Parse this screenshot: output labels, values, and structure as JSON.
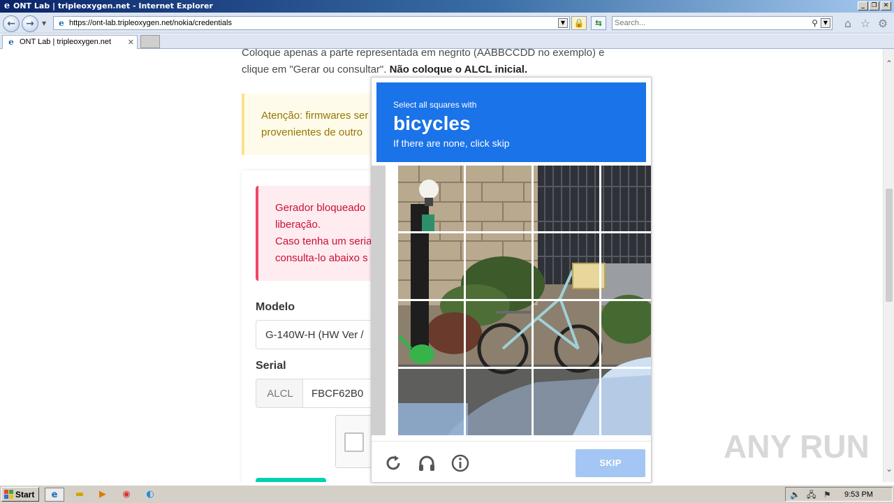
{
  "window": {
    "title": "ONT Lab | tripleoxygen.net - Internet Explorer",
    "minimize": "_",
    "restore": "❐",
    "close": "✕"
  },
  "address_bar": {
    "url": "https://ont-lab.tripleoxygen.net/nokia/credentials",
    "search_placeholder": "Search..."
  },
  "tabs": [
    {
      "label": "ONT Lab | tripleoxygen.net",
      "close": "✕"
    }
  ],
  "page": {
    "intro_line1": "Coloque apenas a parte representada em negrito (AABBCCDD no exemplo) e",
    "intro_line2_normal": "clique em \"Gerar ou consultar\".",
    "intro_line2_bold": "Não coloque o ALCL inicial.",
    "warning_line1": "Atenção: firmwares ser",
    "warning_line2": "provenientes de outro",
    "danger_line1": "Gerador bloqueado",
    "danger_line2": "liberação.",
    "danger_line3": "Caso tenha um seria",
    "danger_line4": "consulta-lo abaixo s",
    "model_label": "Modelo",
    "model_value": "G-140W-H (HW Ver /",
    "serial_label": "Serial",
    "serial_prefix": "ALCL",
    "serial_value": "FBCF62B0"
  },
  "captcha": {
    "instruction": "Select all squares with",
    "target": "bicycles",
    "hint": "If there are none, click skip",
    "skip_label": "SKIP",
    "icons": [
      "reload-icon",
      "audio-icon",
      "info-icon"
    ],
    "grid_rows": 4,
    "grid_cols": 4
  },
  "watermark": "ANY RUN",
  "taskbar": {
    "start_label": "Start",
    "apps": [
      "ie-icon",
      "folder-icon",
      "media-player-icon",
      "chrome-icon",
      "edge-icon"
    ],
    "clock": "9:53 PM"
  },
  "colors": {
    "captcha_blue": "#1a73e8",
    "skip_disabled": "#a3c6f5",
    "danger_text": "#cc0f35",
    "warning_text": "#947600"
  }
}
